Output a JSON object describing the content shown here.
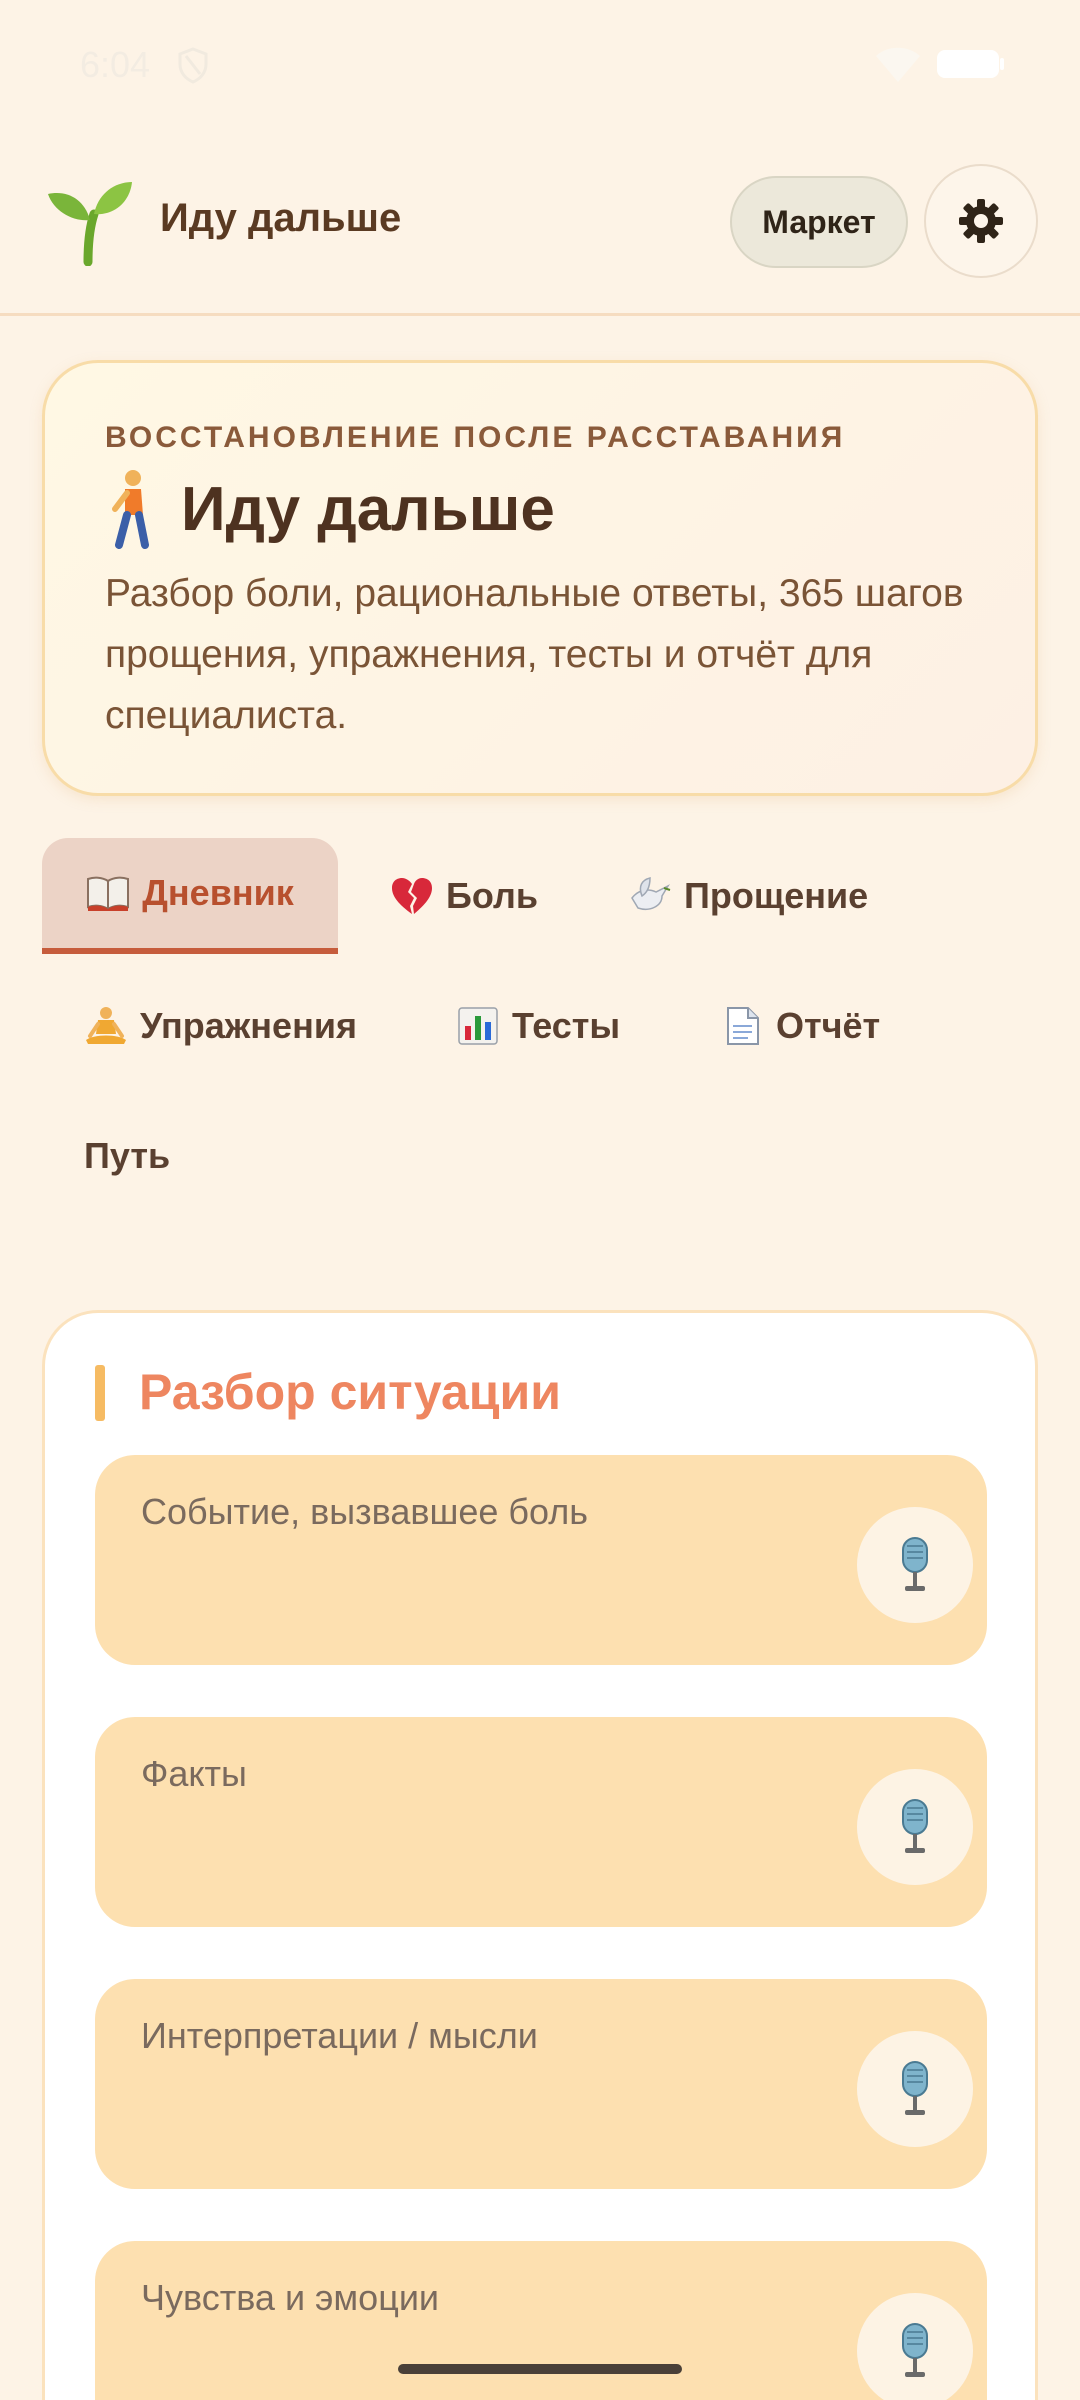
{
  "status": {
    "time": "6:04"
  },
  "header": {
    "title": "Иду дальше",
    "market_label": "Маркет"
  },
  "hero": {
    "overline": "ВОССТАНОВЛЕНИЕ ПОСЛЕ РАССТАВАНИЯ",
    "title": "Иду дальше",
    "description": "Разбор боли, рациональные ответы, 365 шагов прощения, упражнения, тесты и отчёт для специалиста."
  },
  "tabs": [
    {
      "label": "Дневник",
      "icon": "book-icon",
      "active": true
    },
    {
      "label": "Боль",
      "icon": "broken-heart-icon",
      "active": false
    },
    {
      "label": "Прощение",
      "icon": "dove-icon",
      "active": false
    },
    {
      "label": "Упражнения",
      "icon": "meditation-icon",
      "active": false
    },
    {
      "label": "Тесты",
      "icon": "bar-chart-icon",
      "active": false
    },
    {
      "label": "Отчёт",
      "icon": "document-icon",
      "active": false
    },
    {
      "label": "Путь",
      "icon": "",
      "active": false
    }
  ],
  "section": {
    "title": "Разбор ситуации",
    "fields": [
      {
        "label": "Событие, вызвавшее боль",
        "icon": "microphone-icon"
      },
      {
        "label": "Факты",
        "icon": "microphone-icon"
      },
      {
        "label": "Интерпретации / мысли",
        "icon": "microphone-icon"
      },
      {
        "label": "Чувства и эмоции",
        "icon": "microphone-icon"
      }
    ]
  },
  "colors": {
    "background": "#fdf3e6",
    "accent": "#c65c3c",
    "section_title": "#ee8660",
    "field_bg": "#fde0b0"
  }
}
